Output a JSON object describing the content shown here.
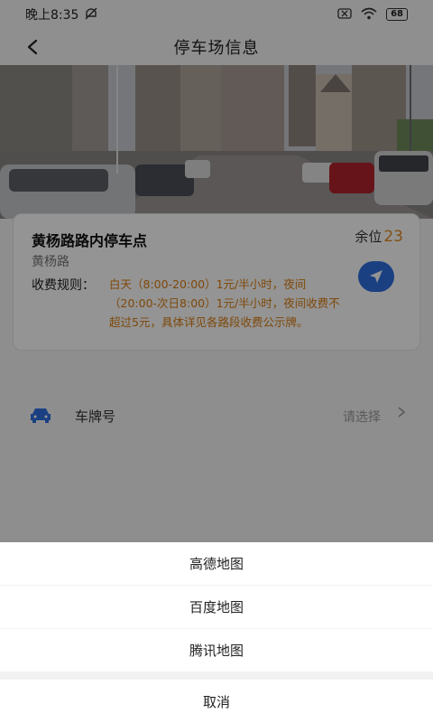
{
  "status_bar": {
    "time": "晚上8:35",
    "battery": "68"
  },
  "nav": {
    "title": "停车场信息"
  },
  "lot": {
    "name": "黄杨路路内停车点",
    "spaces_label": "余位",
    "spaces_count": "23",
    "road": "黄杨路",
    "rules_label": "收费规则：",
    "rules_text": "白天（8:00-20:00）1元/半小时，夜间（20:00-次日8:00）1元/半小时，夜间收费不超过5元，具体详见各路段收费公示牌。"
  },
  "plate": {
    "label": "车牌号",
    "placeholder": "请选择"
  },
  "map_sheet": {
    "options": [
      "高德地图",
      "百度地图",
      "腾讯地图"
    ],
    "cancel": "取消"
  },
  "colors": {
    "accent_blue": "#2f6ee0",
    "rules_orange": "#d97d10",
    "spaces_orange": "#e08a1e"
  }
}
